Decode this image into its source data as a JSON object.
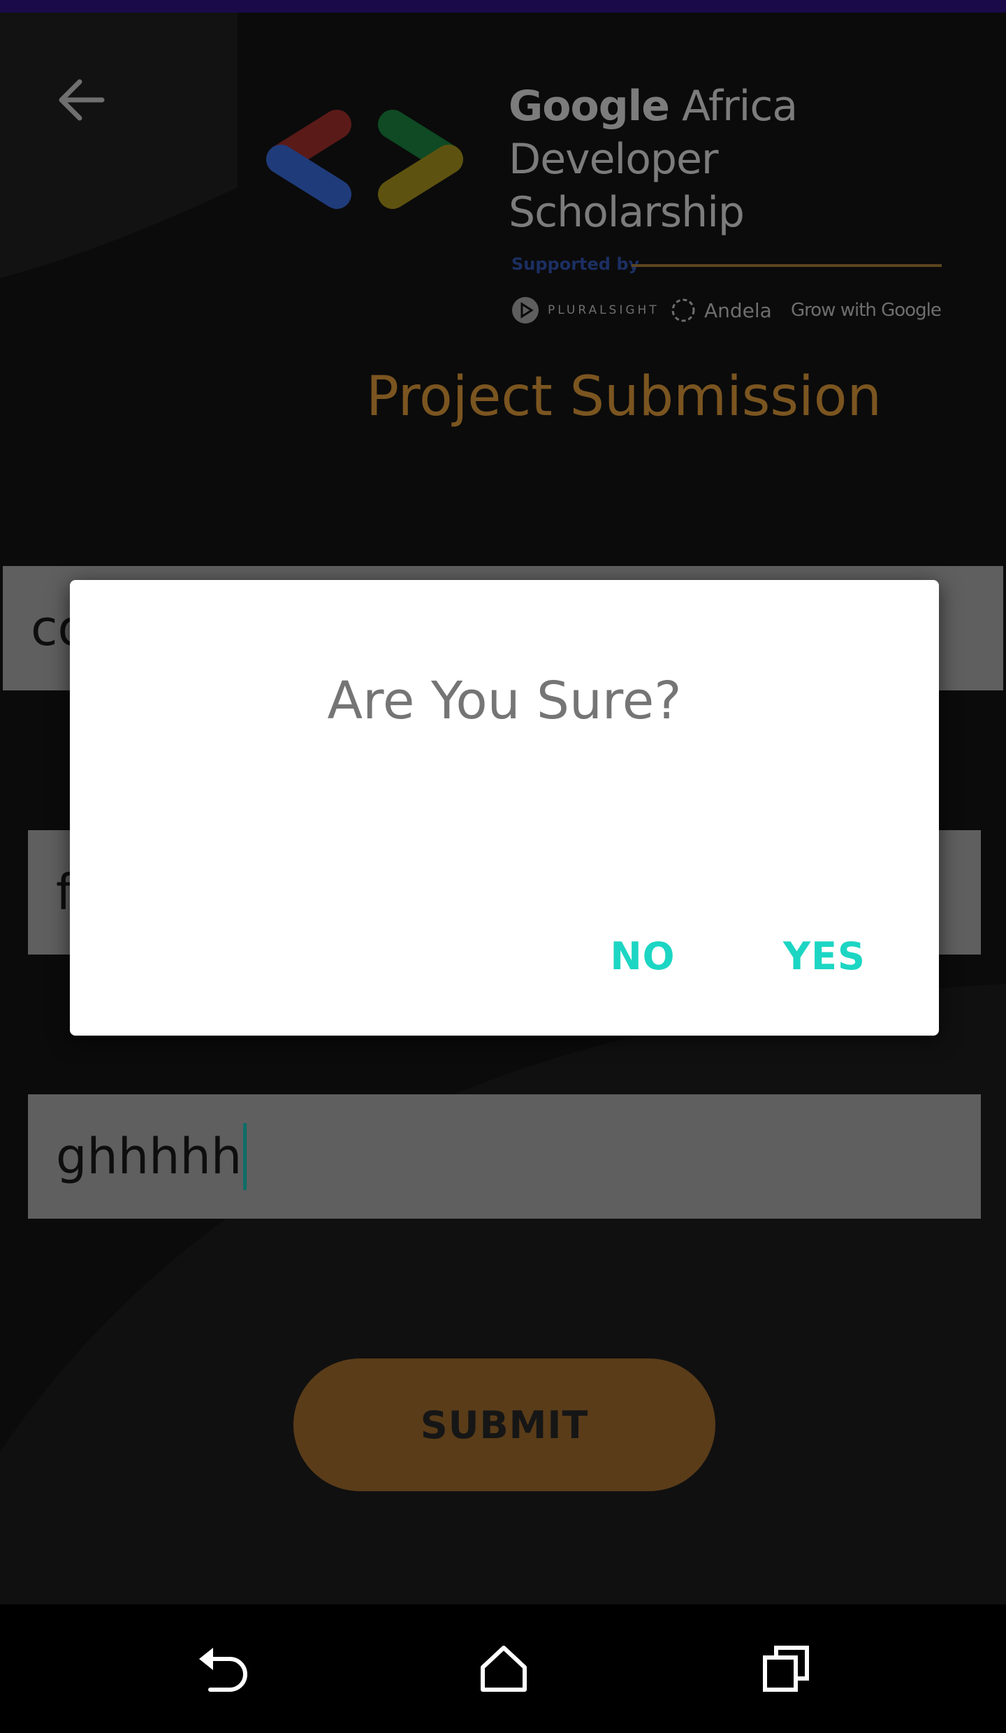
{
  "header": {
    "brand_word1": "Google",
    "brand_word2": " Africa",
    "brand_line2": "Developer Scholarship",
    "supported_by": "Supported by",
    "partners": [
      "PLURALSIGHT",
      "Andela",
      "Grow with Google"
    ]
  },
  "page_title": "Project Submission",
  "form": {
    "field1_value": "co",
    "field2_value": "f",
    "field3_value": "ghhhhh",
    "submit_label": "SUBMIT"
  },
  "dialog": {
    "title": "Are You Sure?",
    "no_label": "NO",
    "yes_label": "YES"
  },
  "colors": {
    "accent_gold": "#7b5520",
    "dialog_button": "#1cd6c3",
    "submit_bg": "#5a3c19"
  },
  "icons": {
    "back": "arrow-left-icon",
    "nav_back": "nav-back-icon",
    "nav_home": "home-icon",
    "nav_recents": "recents-icon"
  }
}
